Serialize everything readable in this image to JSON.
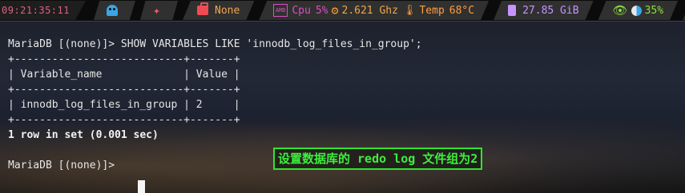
{
  "statusbar": {
    "clock": "09:21:35:11",
    "network_label": "None",
    "cpu_label": "Cpu",
    "cpu_percent": "5%",
    "cpu_freq": "2.621 Ghz",
    "temp_label": "Temp",
    "temp_value": "68°C",
    "memory": "27.85 GiB",
    "brightness": "35%",
    "amd_badge": "AMD",
    "colors": {
      "clock": "#e06082",
      "ghost": "#3aa6e6",
      "star": "#f2556d",
      "network": "#ef4b55",
      "cpu": "#d94fc3",
      "temp": "#ff9e3d",
      "memory": "#c694ff",
      "brightness": "#8de03a",
      "volume": "#ff5f57"
    },
    "icons": [
      "ghost-icon",
      "sparkle-icon",
      "briefcase-icon",
      "amd-chip-icon",
      "gear-icon",
      "thermometer-icon",
      "memory-icon",
      "eye-icon",
      "moon-icon",
      "volume-icon"
    ]
  },
  "terminal": {
    "lines": [
      "MariaDB [(none)]> SHOW VARIABLES LIKE 'innodb_log_files_in_group';",
      "+---------------------------+-------+",
      "| Variable_name             | Value |",
      "+---------------------------+-------+",
      "| innodb_log_files_in_group | 2     |",
      "+---------------------------+-------+",
      "1 row in set (0.001 sec)",
      "",
      "MariaDB [(none)]> "
    ],
    "table": {
      "columns": [
        "Variable_name",
        "Value"
      ],
      "rows": [
        [
          "innodb_log_files_in_group",
          "2"
        ]
      ]
    }
  },
  "annotation": {
    "text": "设置数据库的 redo log 文件组为2",
    "color": "#2ee52e"
  }
}
